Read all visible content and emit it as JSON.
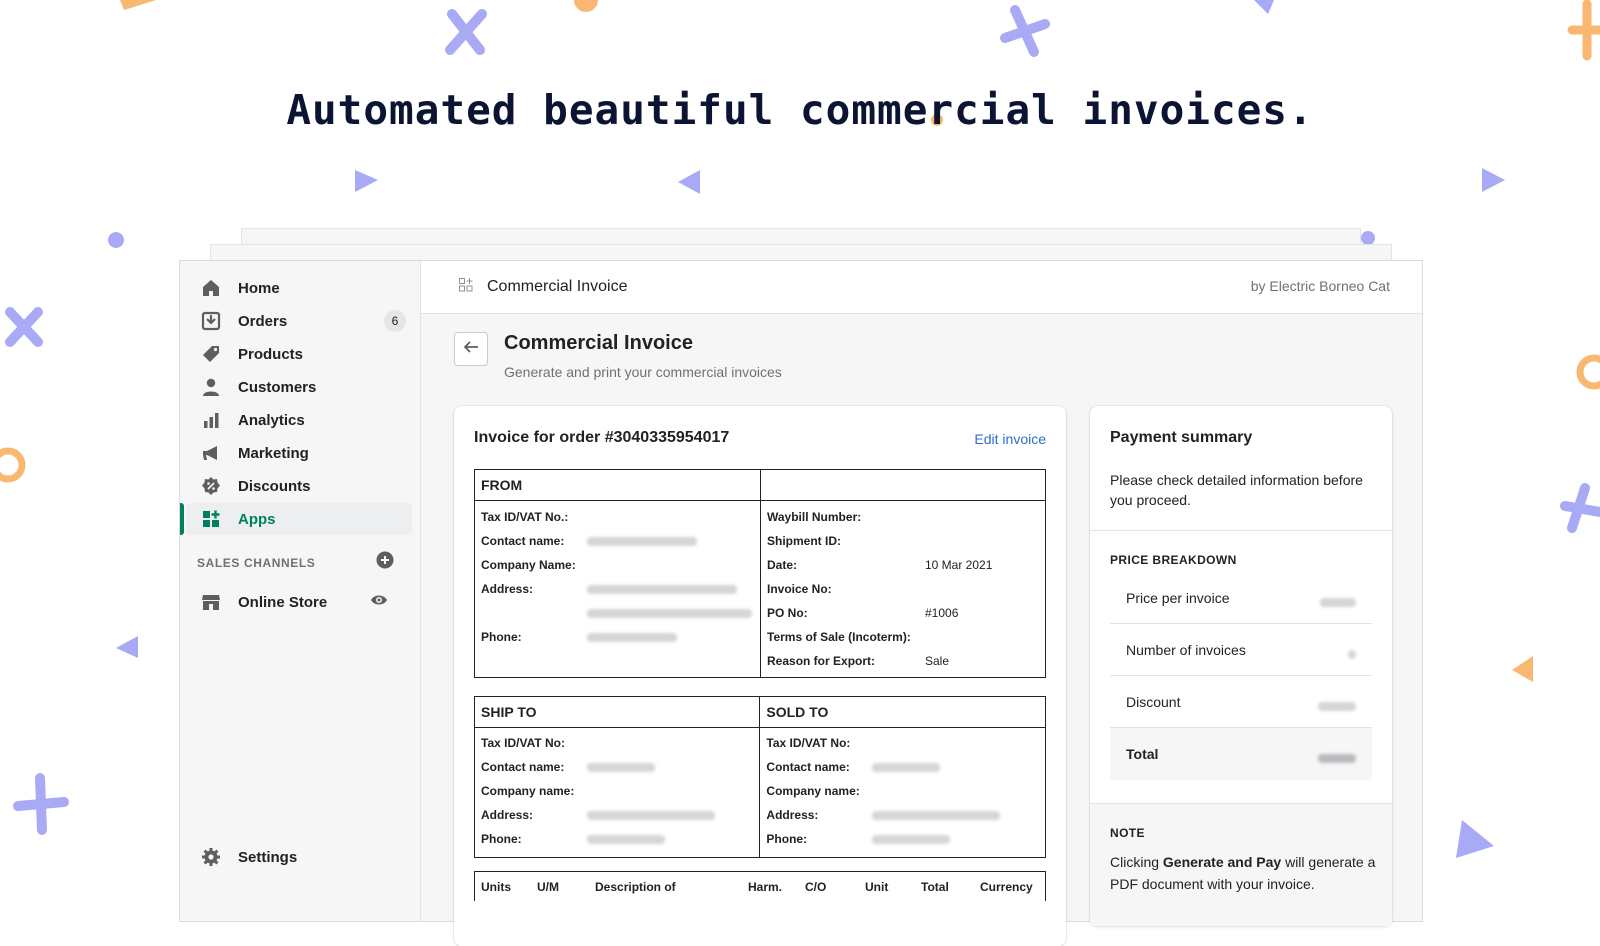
{
  "hero": {
    "title": "Automated beautiful commercial invoices."
  },
  "colors": {
    "accent_green": "#008060",
    "link_blue": "#2c6ecb",
    "deco_purple": "#a9aaf5",
    "deco_orange": "#f9b872"
  },
  "sidebar": {
    "items": [
      {
        "label": "Home",
        "icon": "home-icon"
      },
      {
        "label": "Orders",
        "icon": "orders-icon",
        "badge": "6"
      },
      {
        "label": "Products",
        "icon": "tag-icon"
      },
      {
        "label": "Customers",
        "icon": "person-icon"
      },
      {
        "label": "Analytics",
        "icon": "bar-chart-icon"
      },
      {
        "label": "Marketing",
        "icon": "megaphone-icon"
      },
      {
        "label": "Discounts",
        "icon": "discount-icon"
      },
      {
        "label": "Apps",
        "icon": "apps-icon",
        "active": true
      }
    ],
    "sales_channels_label": "SALES CHANNELS",
    "online_store": "Online Store",
    "settings": "Settings"
  },
  "topbar": {
    "app_title": "Commercial Invoice",
    "by": "by Electric Borneo Cat"
  },
  "page": {
    "title": "Commercial Invoice",
    "subtitle": "Generate and print your commercial invoices"
  },
  "invoice": {
    "title": "Invoice for order #3040335954017",
    "edit_label": "Edit invoice",
    "from_header": "FROM",
    "from_fields": {
      "tax": "Tax ID/VAT No.:",
      "contact": "Contact name:",
      "company": "Company Name:",
      "address": "Address:",
      "phone": "Phone:"
    },
    "right_fields": {
      "waybill": "Waybill Number:",
      "shipment": "Shipment ID:",
      "date": "Date:",
      "date_value": "10 Mar 2021",
      "invoice_no": "Invoice No:",
      "po": "PO No:",
      "po_value": "#1006",
      "terms": "Terms of Sale (Incoterm):",
      "reason": "Reason for Export:",
      "reason_value": "Sale"
    },
    "ship_to_header": "SHIP TO",
    "sold_to_header": "SOLD TO",
    "party_fields": {
      "tax": "Tax ID/VAT No:",
      "contact": "Contact name:",
      "company": "Company name:",
      "address": "Address:",
      "phone": "Phone:"
    },
    "items_columns": [
      "Units",
      "U/M",
      "Description of",
      "Harm.",
      "C/O",
      "Unit",
      "Total",
      "Currency"
    ]
  },
  "payment": {
    "title": "Payment summary",
    "desc": "Please check detailed information before you proceed.",
    "breakdown_label": "PRICE BREAKDOWN",
    "rows": [
      {
        "label": "Price per invoice"
      },
      {
        "label": "Number of invoices"
      },
      {
        "label": "Discount"
      },
      {
        "label": "Total"
      }
    ],
    "note_label": "NOTE",
    "note_pre": "Clicking ",
    "note_bold": "Generate and Pay",
    "note_post": " will generate a PDF document with your invoice."
  }
}
